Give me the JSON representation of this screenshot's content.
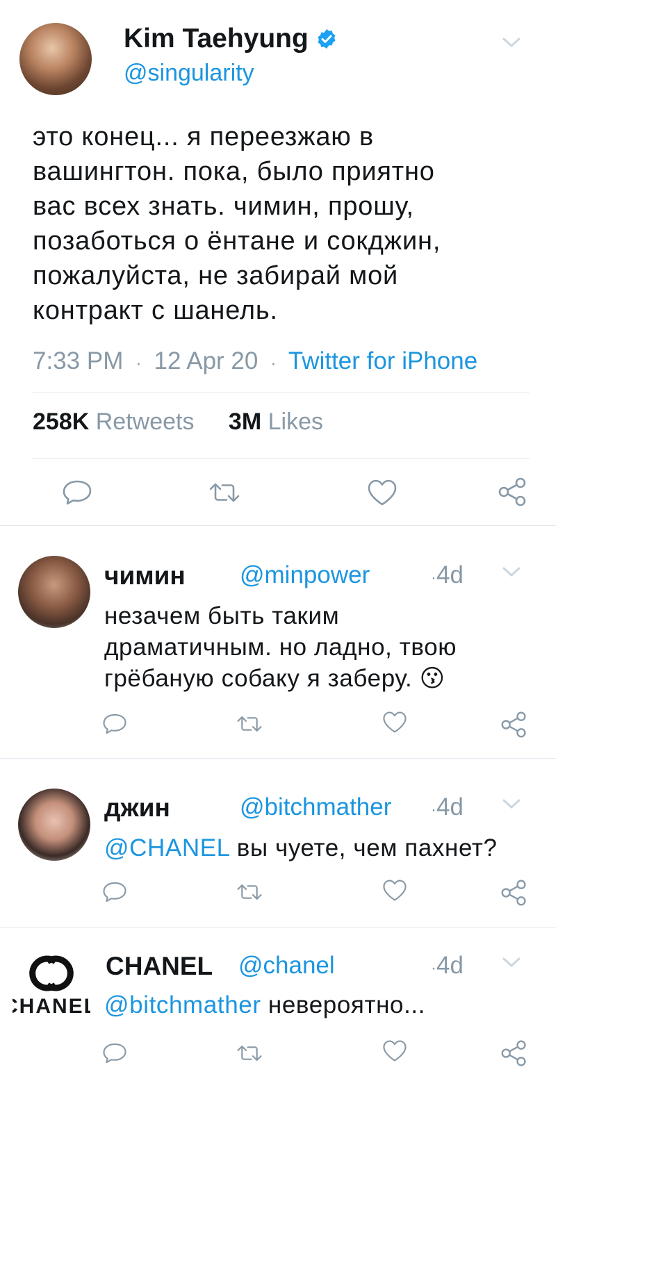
{
  "main_tweet": {
    "name": "Kim Taehyung",
    "handle": "@singularity",
    "text_lines": [
      "это конец... я переезжаю в",
      "вашингтон. пока, было приятно",
      "вас всех знать. чимин, прошу,",
      "позаботься о ёнтане и сокджин,",
      "пожалуйста, не забирай мой",
      "контракт с шанель."
    ],
    "time": "7:33 PM",
    "date": "12 Apr 20",
    "source": "Twitter for iPhone",
    "sep": "·",
    "retweets_count": "258K",
    "retweets_label": "Retweets",
    "likes_count": "3M",
    "likes_label": "Likes"
  },
  "replies": [
    {
      "name": "чимин",
      "handle": "@minpower",
      "age": "4d",
      "lines": [
        "незачем быть таким",
        "драматичным. но ладно, твою",
        "грёбаную собаку я заберу."
      ],
      "emoji": "😗"
    },
    {
      "name": "джин",
      "handle": "@bitchmather",
      "age": "4d",
      "mention": "@CHANEL",
      "text": " вы чуете, чем пахнет?"
    },
    {
      "name": "CHANEL",
      "handle": "@chanel",
      "age": "4d",
      "mention": "@bitchmather",
      "text": " невероятно...",
      "logo_text": "CHANEL"
    }
  ],
  "icons": [
    "reply-icon",
    "retweet-icon",
    "like-icon",
    "share-icon",
    "chevron-down-icon",
    "verified-badge-icon"
  ],
  "colors": {
    "link": "#1b95e0",
    "muted": "#8899a6",
    "divider": "#e1e8ed",
    "verified": "#1da1f2"
  }
}
